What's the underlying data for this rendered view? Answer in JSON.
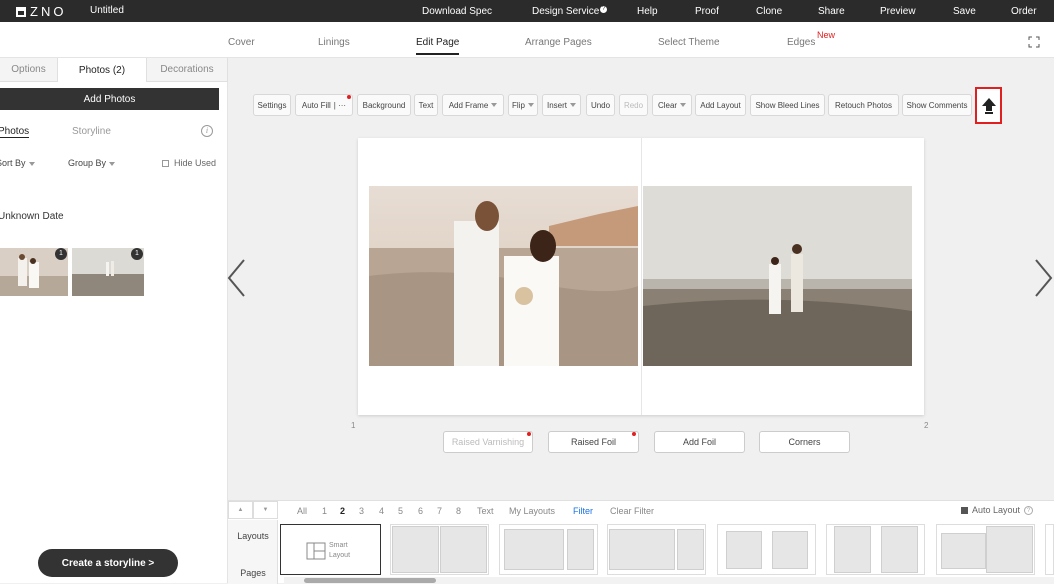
{
  "topbar": {
    "logo_text": "ZNO",
    "document_title": "Untitled",
    "nav": [
      "Download Spec",
      "Design Service",
      "Help",
      "Proof",
      "Clone",
      "Share",
      "Preview",
      "Save",
      "Order"
    ]
  },
  "subnav": {
    "tabs": [
      "Cover",
      "Linings",
      "Edit Page",
      "Arrange Pages",
      "Select Theme",
      "Edges"
    ],
    "active": "Edit Page",
    "new_badge": "New"
  },
  "left_panel": {
    "tabs": [
      "Options",
      "Photos (2)",
      "Decorations"
    ],
    "active_tab": "Photos (2)",
    "add_photos_label": "Add Photos",
    "photo_tabs": [
      "Photos",
      "Storyline"
    ],
    "sort_by": "Sort By",
    "group_by": "Group By",
    "hide_used": "Hide Used",
    "group_label": "Unknown Date",
    "thumbnails": [
      {
        "badge": "1"
      },
      {
        "badge": "1"
      }
    ],
    "storyline_button": "Create a storyline >"
  },
  "toolbar": {
    "buttons": [
      "Settings",
      "Auto Fill",
      "Background",
      "Text",
      "Add Frame",
      "Flip",
      "Insert",
      "Undo",
      "Redo",
      "Clear",
      "Add Layout",
      "Show Bleed Lines",
      "Retouch Photos",
      "Show Comments"
    ],
    "disabled": [
      "Redo"
    ],
    "upload_icon": "upload-arrow-icon"
  },
  "canvas": {
    "left_page_number": "1",
    "right_page_number": "2"
  },
  "bottom_actions": {
    "buttons": [
      "Raised Varnishing",
      "Raised Foil",
      "Add Foil",
      "Corners"
    ],
    "disabled": [
      "Raised Varnishing"
    ]
  },
  "layout_strip": {
    "side_tabs": [
      "Layouts",
      "Pages"
    ],
    "page_filters": [
      "All",
      "1",
      "2",
      "3",
      "4",
      "5",
      "6",
      "7",
      "8",
      "Text",
      "My Layouts",
      "Filter",
      "Clear Filter"
    ],
    "selected_filter": "2",
    "auto_layout_label": "Auto Layout",
    "smart_layout_label": "Smart Layout"
  },
  "colors": {
    "topbar_bg": "#2b2b2b",
    "accent_red": "#e02020",
    "filter_blue": "#1a73e8"
  }
}
